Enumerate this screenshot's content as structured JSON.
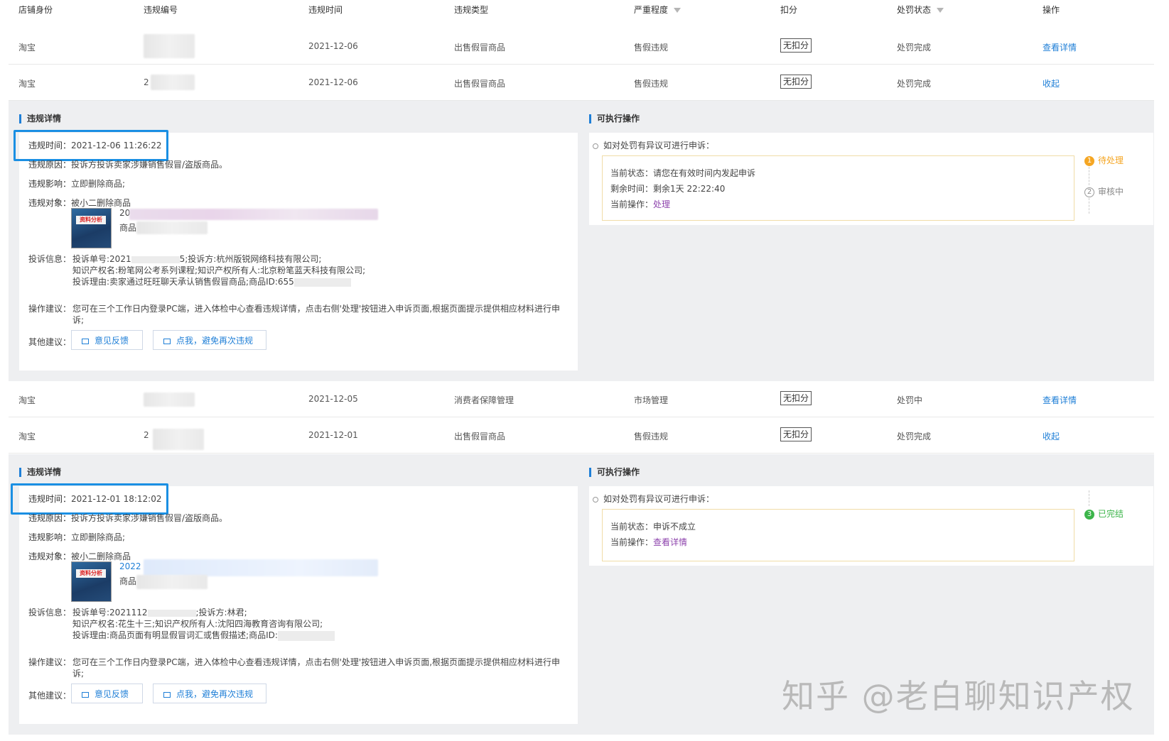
{
  "header": {
    "col_shop": "店铺身份",
    "col_id": "违规编号",
    "col_time": "违规时间",
    "col_type": "违规类型",
    "col_severity": "严重程度",
    "col_deduct": "扣分",
    "col_status": "处罚状态",
    "col_action": "操作"
  },
  "rows": [
    {
      "shop": "淘宝",
      "time": "2021-12-06",
      "type": "出售假冒商品",
      "severity": "售假违规",
      "deduct": "无扣分",
      "status": "处罚完成",
      "action": "查看详情"
    },
    {
      "shop": "淘宝",
      "id_prefix": "2",
      "time": "2021-12-06",
      "type": "出售假冒商品",
      "severity": "售假违规",
      "deduct": "无扣分",
      "status": "处罚完成",
      "action": "收起"
    },
    {
      "shop": "淘宝",
      "time": "2021-12-05",
      "type": "消费者保障管理",
      "severity": "市场管理",
      "deduct": "无扣分",
      "status": "处罚中",
      "action": "查看详情"
    },
    {
      "shop": "淘宝",
      "id_prefix": "2",
      "time": "2021-12-01",
      "type": "出售假冒商品",
      "severity": "售假违规",
      "deduct": "无扣分",
      "status": "处罚完成",
      "action": "收起"
    }
  ],
  "labels": {
    "detail_title": "违规详情",
    "ops_title": "可执行操作",
    "time": "违规时间：",
    "reason": "违规原因：",
    "impact": "违规影响：",
    "target": "违规对象：",
    "complaint": "投诉信息：",
    "advice": "操作建议：",
    "other": "其他建议：",
    "appeal_hint": "如对处罚有异议可进行申诉：",
    "cur_status": "当前状态：",
    "remaining": "剩余时间：",
    "cur_op": "当前操作："
  },
  "detail1": {
    "time": "2021-12-06 11:26:22",
    "reason": "投诉方投诉卖家涉嫌销售假冒/盗版商品。",
    "impact": "立即删除商品;",
    "target": "被小二删除商品",
    "item_title": "20",
    "item_sub": "商品",
    "complaint_l1a": "投诉单号:2021",
    "complaint_l1b": "5;投诉方:杭州版锐网络科技有限公司;",
    "complaint_l2": "知识产权名:粉笔网公考系列课程;知识产权所有人:北京粉笔蓝天科技有限公司;",
    "complaint_l3": "投诉理由:卖家通过旺旺聊天承认销售假冒商品;商品ID:655",
    "advice_l1": "您可在三个工作日内登录PC端，进入体检中心查看违规详情，点击右侧'处理'按钮进入申诉页面,根据页面提示提供相应材料进行申",
    "advice_l2": "诉;",
    "btn_feedback": "意见反馈",
    "btn_avoid": "点我，避免再次违规",
    "ops_status": "请您在有效时间内发起申诉",
    "ops_remaining": "剩余1天 22:22:40",
    "ops_action": "处理",
    "step1": "待处理",
    "step2": "审核中",
    "step1_num": "1",
    "step2_num": "2"
  },
  "detail2": {
    "time": "2021-12-01 18:12:02",
    "reason": "投诉方投诉卖家涉嫌销售假冒/盗版商品。",
    "impact": "立即删除商品;",
    "target": "被小二删除商品",
    "item_title": "2022",
    "item_sub": "商品",
    "complaint_l1a": "投诉单号:2021112",
    "complaint_l1b": ";投诉方:林君;",
    "complaint_l2": "知识产权名:花生十三;知识产权所有人:沈阳四海教育咨询有限公司;",
    "complaint_l3": "投诉理由:商品页面有明显假冒词汇或售假描述;商品ID:",
    "advice_l1": "您可在三个工作日内登录PC端，进入体检中心查看违规详情，点击右侧'处理'按钮进入申诉页面,根据页面提示提供相应材料进行申",
    "advice_l2": "诉;",
    "btn_feedback": "意见反馈",
    "btn_avoid": "点我，避免再次违规",
    "ops_status": "申诉不成立",
    "ops_action": "查看详情",
    "step3": "已完结",
    "step3_num": "3"
  },
  "thumb_text": "资料分析",
  "watermark": "知乎 @老白聊知识产权",
  "colors": {
    "accent": "#1f7fd7",
    "highlight": "#1a8fe3",
    "panel_bg": "#eeeff1",
    "pending_orange": "#f5a623",
    "done_green": "#3cb54a",
    "link_purple": "#8e44ad"
  }
}
